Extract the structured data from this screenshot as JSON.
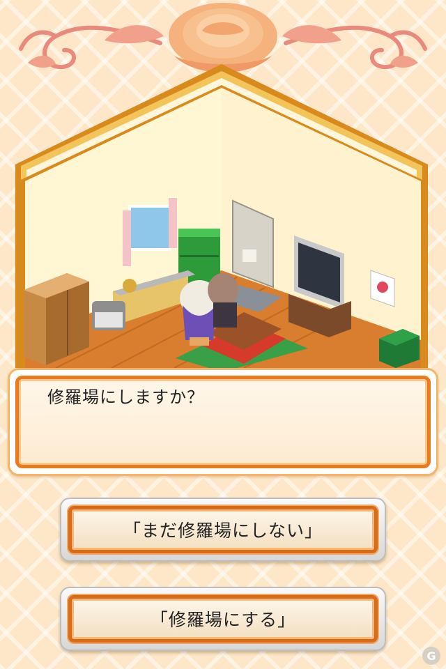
{
  "dialog": {
    "text": "修羅場にしますか？"
  },
  "choices": [
    {
      "label": "「まだ修羅場にしない」"
    },
    {
      "label": "「修羅場にする」"
    }
  ],
  "icons": {
    "rose": "rose-ornament-icon",
    "corner": "g-logo-icon"
  },
  "colors": {
    "accent": "#ec7a1c",
    "background": "#fde7c8",
    "wall": "#fff5d2",
    "floor": "#d9782a"
  }
}
